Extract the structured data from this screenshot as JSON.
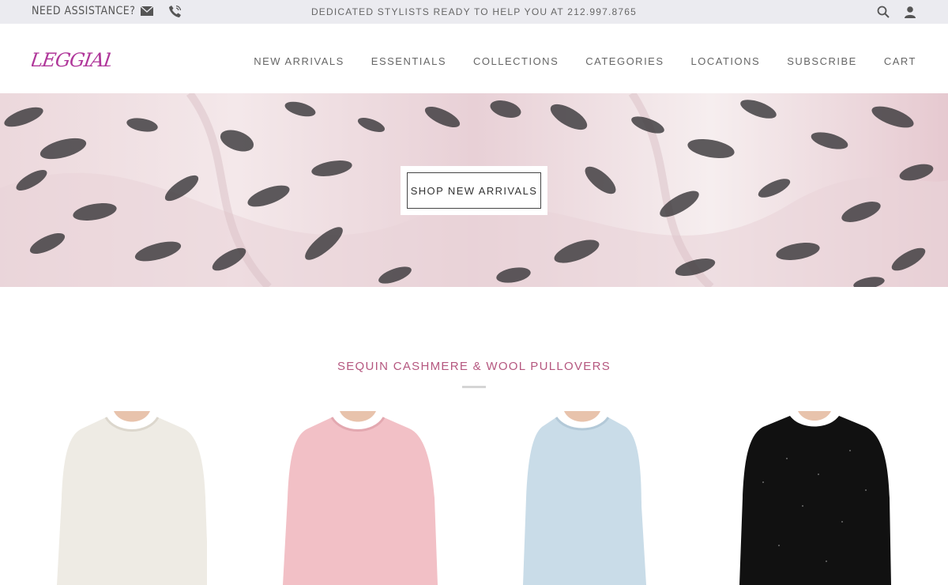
{
  "topbar": {
    "assistance_label": "NEED ASSISTANCE?",
    "promo_text": "DEDICATED STYLISTS READY TO HELP YOU AT 212.997.8765",
    "icons": [
      "mail-icon",
      "phone-icon",
      "search-icon",
      "account-icon"
    ]
  },
  "header": {
    "logo_text": "LEGGIADRO",
    "nav": [
      {
        "label": "NEW ARRIVALS"
      },
      {
        "label": "ESSENTIALS"
      },
      {
        "label": "COLLECTIONS"
      },
      {
        "label": "CATEGORIES"
      },
      {
        "label": "LOCATIONS"
      },
      {
        "label": "SUBSCRIBE"
      },
      {
        "label": "CART"
      }
    ]
  },
  "hero": {
    "button_label": "SHOP NEW ARRIVALS"
  },
  "section": {
    "title": "SEQUIN CASHMERE & WOOL PULLOVERS",
    "products": [
      {
        "color_name": "ivory",
        "color": "#eeebe4"
      },
      {
        "color_name": "pink",
        "color": "#f2c0c6"
      },
      {
        "color_name": "light blue",
        "color": "#c9dce8"
      },
      {
        "color_name": "black",
        "color": "#111111"
      }
    ]
  },
  "colors": {
    "accent": "#b5577f",
    "logo": "#b0379a",
    "topbar_bg": "#ebebf0"
  }
}
